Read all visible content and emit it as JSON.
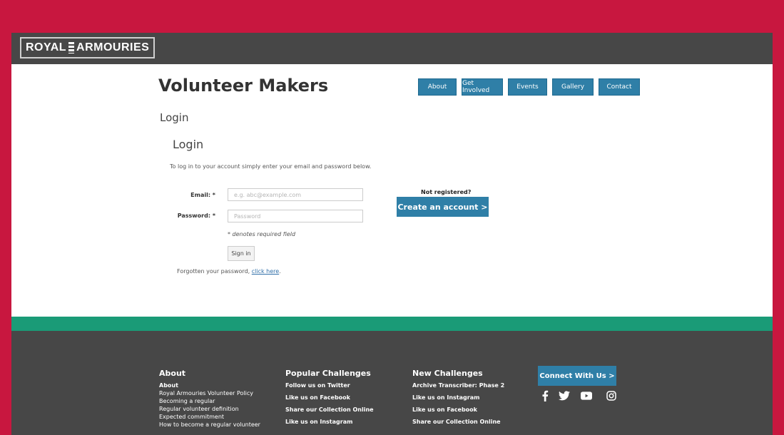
{
  "logo": {
    "left": "ROYAL",
    "right": "ARMOURIES"
  },
  "site": {
    "title": "Volunteer Makers"
  },
  "nav": {
    "items": [
      "About",
      "Get Involved",
      "Events",
      "Gallery",
      "Contact"
    ]
  },
  "page": {
    "heading": "Login"
  },
  "form": {
    "heading": "Login",
    "intro": "To log in to your account simply enter your email and password below.",
    "email_label": "Email: *",
    "email_placeholder": "e.g. abc@example.com",
    "password_label": "Password: *",
    "password_placeholder": "Password",
    "required_note": "* denotes required field",
    "signin_label": "Sign in",
    "forgot_text": "Forgotten your password, ",
    "forgot_link": "click here",
    "forgot_end": "."
  },
  "register": {
    "prompt": "Not registered?",
    "button": "Create an account >"
  },
  "footer": {
    "about": {
      "title": "About",
      "items": [
        "About",
        "Royal Armouries Volunteer Policy",
        "Becoming a regular",
        "Regular volunteer definition",
        "Expected commitment",
        "How to become a regular volunteer"
      ]
    },
    "popular": {
      "title": "Popular Challenges",
      "items": [
        "Follow us on Twitter",
        "Like us on Facebook",
        "Share our Collection Online",
        "Like us on Instagram"
      ]
    },
    "new": {
      "title": "New Challenges",
      "items": [
        "Archive Transcriber: Phase 2",
        "Like us on Instagram",
        "Like us on Facebook",
        "Share our Collection Online"
      ]
    },
    "connect": {
      "label": "Connect With Us >"
    }
  },
  "social_icons": [
    "facebook-icon",
    "twitter-icon",
    "youtube-icon",
    "instagram-icon"
  ],
  "colors": {
    "frame": "#c8173f",
    "header": "#474747",
    "accent": "#2f7fa7",
    "band": "#1a9b77"
  }
}
